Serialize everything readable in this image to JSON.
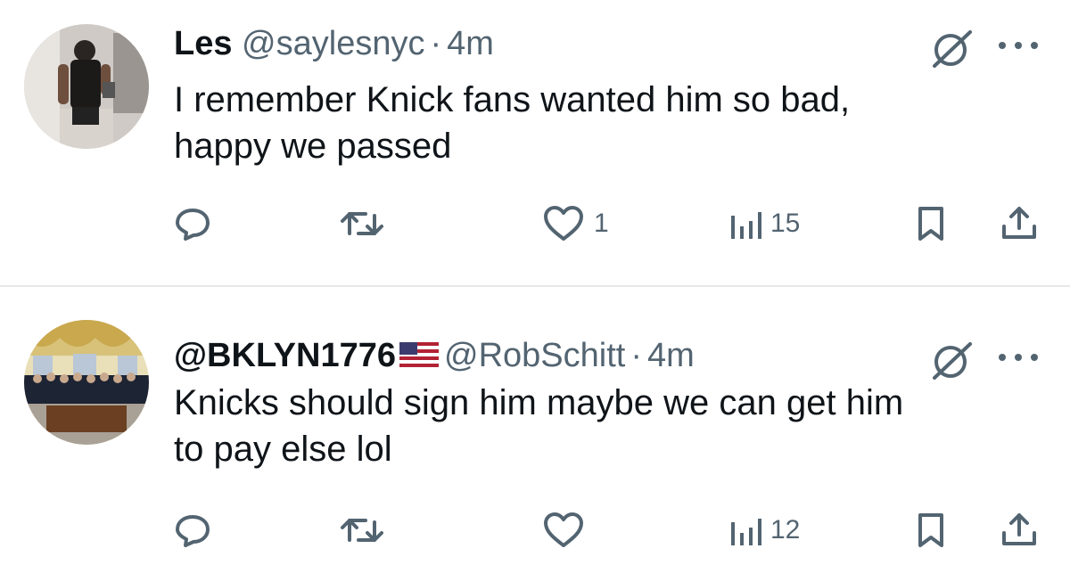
{
  "tweets": [
    {
      "display_name": "Les",
      "handle": "@saylesnyc",
      "separator": "·",
      "time": "4m",
      "text_lines": [
        "I remember Knick fans wanted him so bad,",
        "happy we passed"
      ],
      "likes": "1",
      "views": "15"
    },
    {
      "display_name": "@BKLYN1776",
      "flag_icon": "us-flag-icon",
      "handle": "@RobSchitt",
      "separator": "·",
      "time": "4m",
      "text_lines": [
        "Knicks should sign him maybe we can get him",
        "to pay else lol"
      ],
      "likes": "",
      "views": "12"
    }
  ],
  "icons": {
    "reply": "reply-icon",
    "retweet": "retweet-icon",
    "like": "heart-icon",
    "views": "views-bar-icon",
    "bookmark": "bookmark-icon",
    "share": "share-icon",
    "grok": "grok-icon",
    "more": "more-dots-icon"
  },
  "colors": {
    "text": "#0f1419",
    "secondary": "#536471",
    "divider": "#e6e8ea"
  }
}
